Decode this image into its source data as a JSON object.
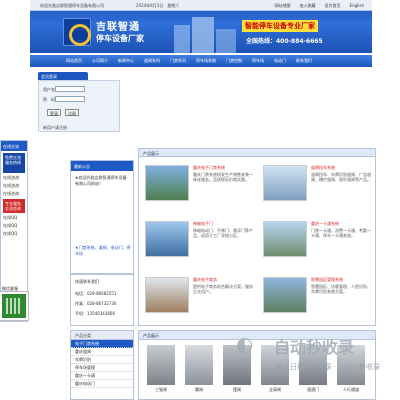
{
  "topbar": {
    "welcome": "欢迎光临吉联智通停车设备有限公司",
    "date": "2024年8月3日　星期六",
    "links": [
      "网站地图",
      "加入收藏",
      "设为首页",
      "English"
    ]
  },
  "header": {
    "brand_name": "吉联智通",
    "brand_sub": "停车设备厂家",
    "slogan": "智能停车设备专业厂家",
    "hotline": "全国热线：400-884-6665"
  },
  "nav": [
    "网站首页",
    "公司简介",
    "新闻中心",
    "道闸系列",
    "门禁系列",
    "停车场系统",
    "门禁控制",
    "停车场",
    "电动门",
    "联系我们"
  ],
  "login": {
    "tab": "会员登录",
    "user_label": "用户名：",
    "pass_label": "密　码：",
    "login_button": "登录",
    "register_button": "注册",
    "note": "新用户请注册"
  },
  "service": {
    "title": "在线交流",
    "banner": "免费交流服务热线",
    "items": [
      "在线咨询",
      "在线咨询",
      "在线咨询"
    ],
    "red_banner": "专业服务交流咨询",
    "qq": [
      "在线QQ",
      "在线QQ",
      "在线QQ"
    ],
    "wechat_title": "微信客服"
  },
  "announce": {
    "title": "最新公告",
    "body": "★欢迎光临吉联智通停车设备有限公司网站！",
    "link": "★门禁系统、道闸、电动门、停车场"
  },
  "contact": {
    "title": "快速联系我们",
    "lines": [
      "电话：028-86682551",
      "传真：028-86732736",
      "手机：13540343666"
    ]
  },
  "main": {
    "breadcrumb": "产品展示",
    "cards": [
      {
        "title": "重庆电子门禁系统",
        "desc": "重庆门禁系统研发生产销售安装一体化服务，品质保证价格实惠。"
      },
      {
        "title": "道闸挡车系统",
        "desc": "道闸挡车、车牌识别道闸、广告道闸、栅栏道闸、直杆道闸等产品。"
      },
      {
        "title": "伸缩电子门",
        "desc": "伸缩电动门、平移门、悬浮门等产品，适用于工厂学校小区。"
      },
      {
        "title": "重庆一卡通系统",
        "desc": "门禁一卡通、消费一卡通、考勤一卡通、停车一卡通系统。"
      },
      {
        "title": "重庆电子商务",
        "desc": "提供电子商务综合解决方案，服务企业用户。"
      },
      {
        "title": "智慧园区管理系统",
        "desc": "智慧园区、访客管理、人脸识别、车牌识别系统方案。"
      }
    ]
  },
  "category": {
    "title": "产品分类",
    "items": [
      "电子门禁系统",
      "重庆道闸",
      "车牌识别",
      "停车场管理",
      "重庆一卡通",
      "重庆电动门"
    ]
  },
  "products": {
    "title": "产品展示",
    "items": [
      {
        "caption": "三辊闸"
      },
      {
        "caption": "翼闸"
      },
      {
        "caption": "摆闸"
      },
      {
        "caption": "全高闸"
      },
      {
        "caption": "速通门"
      },
      {
        "caption": "人行通道"
      }
    ]
  },
  "watermark": {
    "text": "自动秒收录",
    "sub": "数上日榜 · 高收录 · 一次 · 秒收录"
  }
}
